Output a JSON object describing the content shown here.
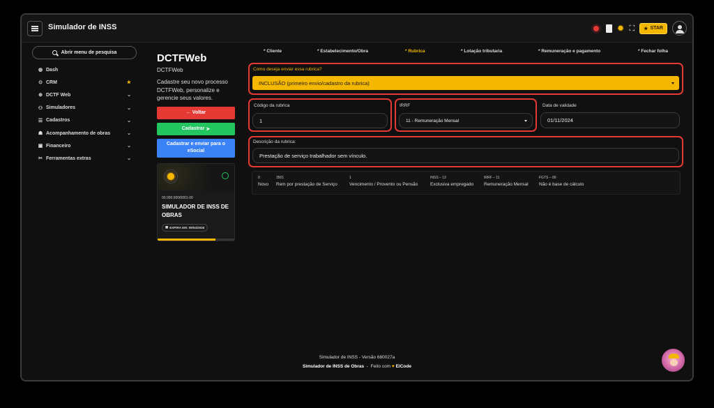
{
  "app": {
    "title": "Simulador de INSS",
    "star_label": "STAR"
  },
  "sidebar": {
    "search_label": "Abrir menu de pesquisa",
    "items": [
      {
        "label": "Dash",
        "icon": "dashboard-icon",
        "right": ""
      },
      {
        "label": "CRM",
        "icon": "crm-icon",
        "right": "star"
      },
      {
        "label": "DCTF Web",
        "icon": "globe-icon",
        "right": "chevron"
      },
      {
        "label": "Simuladores",
        "icon": "people-icon",
        "right": "chevron"
      },
      {
        "label": "Cadastros",
        "icon": "list-icon",
        "right": "chevron"
      },
      {
        "label": "Acompanhamento de obras",
        "icon": "worker-icon",
        "right": "chevron"
      },
      {
        "label": "Financeiro",
        "icon": "money-icon",
        "right": "chevron"
      },
      {
        "label": "Ferramentas extras",
        "icon": "tools-icon",
        "right": "chevron"
      }
    ]
  },
  "panel": {
    "title": "DCTFWeb",
    "subtitle": "DCTFWeb",
    "description": "Cadastre seu novo processo DCTFWeb, personalize e gerencie seus valores.",
    "back_label": "← Voltar",
    "register_label": "Cadastrar",
    "register_send_label": "Cadastrar e enviar para o eSocial",
    "card": {
      "cnpj": "00.000.000/0001-00",
      "name": "SIMULADOR DE INSS DE OBRAS",
      "expiry": "EXPIRA EM: 09/04/2026",
      "progress": 0.75
    }
  },
  "tabs": [
    {
      "label": "* Cliente",
      "active": false
    },
    {
      "label": "* Estabelecimento/Obra",
      "active": false
    },
    {
      "label": "* Rubrica",
      "active": true
    },
    {
      "label": "* Lotação tributaria",
      "active": false
    },
    {
      "label": "* Remuneração e pagamento",
      "active": false
    },
    {
      "label": "* Fechar folha",
      "active": false
    }
  ],
  "form": {
    "send_question": "Como deseja enviar essa rubrica?",
    "send_option": "INCLUSÃO (primeiro envio/cadastro da rubrica)",
    "code_label": "Código da rubrica",
    "code_value": "1",
    "irrf_label": "IRRF",
    "irrf_value": "11 - Remuneração Mensal",
    "validity_label": "Data de validade",
    "validity_value": "01/11/2024",
    "description_label": "Descrição da rubrica:",
    "description_value": "Prestação de serviço trabalhador sem vínculo."
  },
  "summary": [
    {
      "code": "0",
      "desc": "Novo"
    },
    {
      "code": "3501",
      "desc": "Rem por prestação de Serviço"
    },
    {
      "code": "1",
      "desc": "Vencimento / Provento ou Pensão"
    },
    {
      "code": "INSS – 13",
      "desc": "Exclusiva empregado"
    },
    {
      "code": "IRRF – 11",
      "desc": "Remuneração Mensal"
    },
    {
      "code": "FGTS – 00",
      "desc": "Não é base de cálculo"
    }
  ],
  "footer": {
    "version": "Simulador de INSS - Versão 680027a",
    "brand": "Simulador de INSS de Obras",
    "separator": "-",
    "made_with": "Feito com",
    "heart": "♥",
    "maker": "EiCode"
  },
  "colors": {
    "accent": "#f5b800",
    "danger": "#e53935",
    "success": "#22c55e",
    "primary": "#3b82f6"
  }
}
